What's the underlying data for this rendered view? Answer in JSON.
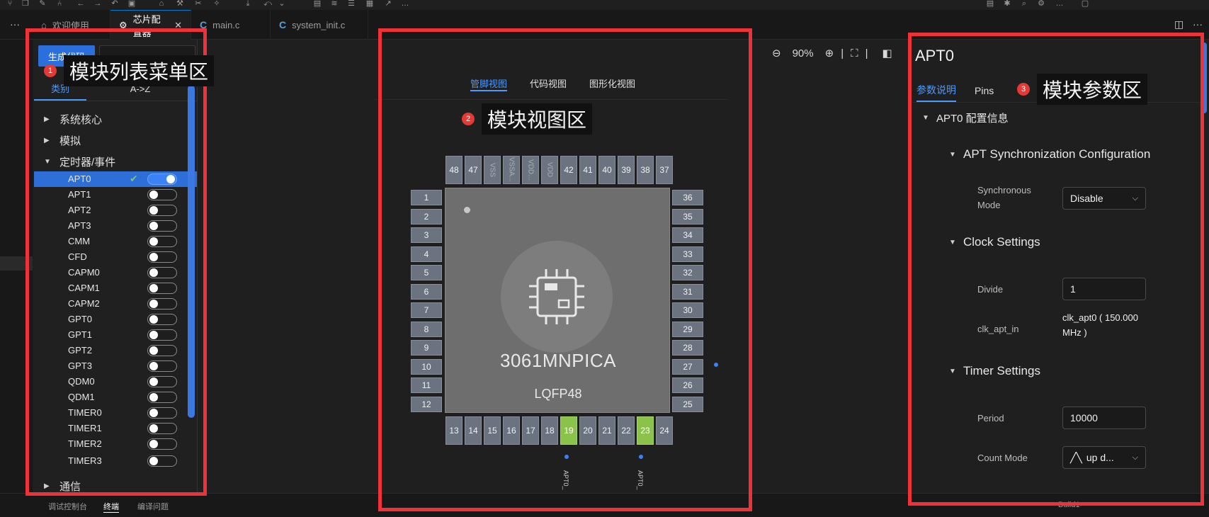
{
  "tabs": [
    {
      "label": "欢迎使用",
      "icon": "home-icon"
    },
    {
      "label": "芯片配置器",
      "icon": "chip-icon",
      "active": true
    },
    {
      "label": "main.c",
      "icon": "c-file-icon"
    },
    {
      "label": "system_init.c",
      "icon": "c-file-icon"
    }
  ],
  "left": {
    "generate_label": "生成代码",
    "tabs": [
      "类别",
      "A->Z"
    ],
    "categories": {
      "core": "系统核心",
      "analog": "模拟",
      "timer": "定时器/事件",
      "comm": "通信"
    },
    "modules": [
      "APT0",
      "APT1",
      "APT2",
      "APT3",
      "CMM",
      "CFD",
      "CAPM0",
      "CAPM1",
      "CAPM2",
      "GPT0",
      "GPT1",
      "GPT2",
      "GPT3",
      "QDM0",
      "QDM1",
      "TIMER0",
      "TIMER1",
      "TIMER2",
      "TIMER3"
    ],
    "enabled_module": "APT0"
  },
  "center": {
    "zoom": "90%",
    "view_tabs": [
      "管脚视图",
      "代码视图",
      "图形化视图"
    ],
    "chip_name": "3061MNPICA",
    "package": "LQFP48",
    "pins_top": [
      "48",
      "47",
      "VSS",
      "VSSA...",
      "VDD...",
      "VDD",
      "42",
      "41",
      "40",
      "39",
      "38",
      "37"
    ],
    "pins_left": [
      "1",
      "2",
      "3",
      "4",
      "5",
      "6",
      "7",
      "8",
      "9",
      "10",
      "11",
      "12"
    ],
    "pins_right": [
      "36",
      "35",
      "34",
      "33",
      "32",
      "31",
      "30",
      "29",
      "28",
      "27",
      "26",
      "25"
    ],
    "pins_bottom": [
      "13",
      "14",
      "15",
      "16",
      "17",
      "18",
      "19",
      "20",
      "21",
      "22",
      "23",
      "24"
    ],
    "pin_labels": [
      "APT0_",
      "APT0_"
    ]
  },
  "right": {
    "title": "APT0",
    "tabs": [
      "参数说明",
      "Pins"
    ],
    "section_main": "APT0 配置信息",
    "sync_section": "APT Synchronization Configuration",
    "sync_label_1": "Synchronous",
    "sync_label_2": "Mode",
    "sync_value": "Disable",
    "clock_section": "Clock Settings",
    "divide_label": "Divide",
    "divide_value": "1",
    "clk_label": "clk_apt_in",
    "clk_value": "clk_apt0 ( 150.000 MHz )",
    "timer_section": "Timer Settings",
    "period_label": "Period",
    "period_value": "10000",
    "count_label": "Count Mode",
    "count_value": "up d..."
  },
  "bottom": {
    "tabs": [
      "调试控制台",
      "终端",
      "编译问题"
    ],
    "build": "Build1"
  },
  "annotations": [
    {
      "num": "1",
      "text": "模块列表菜单区"
    },
    {
      "num": "2",
      "text": "模块视图区"
    },
    {
      "num": "3",
      "text": "模块参数区"
    }
  ]
}
